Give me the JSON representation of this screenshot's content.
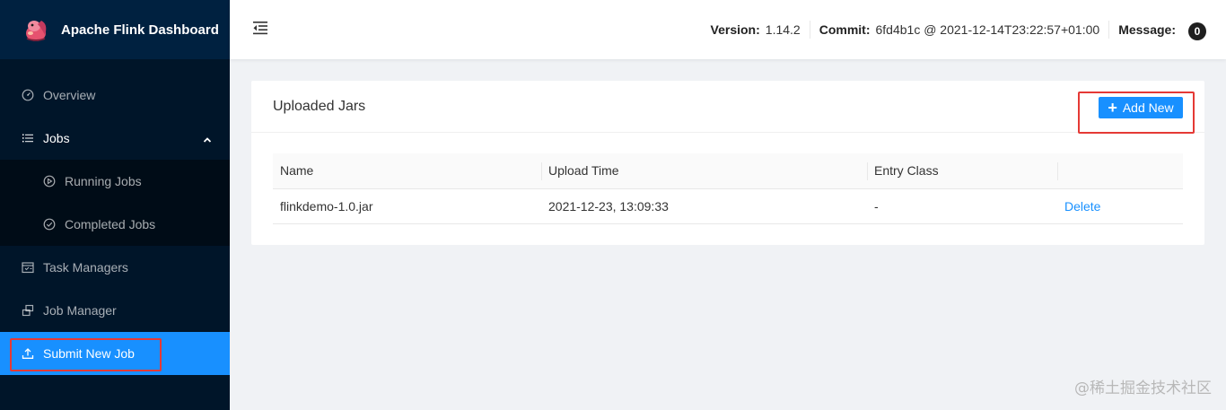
{
  "app": {
    "title": "Apache Flink Dashboard"
  },
  "sidebar": {
    "items": [
      {
        "label": "Overview",
        "icon": "dashboard-icon"
      },
      {
        "label": "Jobs",
        "icon": "list-icon",
        "expanded": true
      },
      {
        "label": "Running Jobs",
        "icon": "play-circle-icon"
      },
      {
        "label": "Completed Jobs",
        "icon": "check-circle-icon"
      },
      {
        "label": "Task Managers",
        "icon": "schedule-icon"
      },
      {
        "label": "Job Manager",
        "icon": "cluster-icon"
      },
      {
        "label": "Submit New Job",
        "icon": "upload-icon",
        "active": true
      }
    ]
  },
  "header": {
    "version_label": "Version:",
    "version_value": "1.14.2",
    "commit_label": "Commit:",
    "commit_value": "6fd4b1c @ 2021-12-14T23:22:57+01:00",
    "message_label": "Message:",
    "message_count": "0"
  },
  "card": {
    "title": "Uploaded Jars",
    "add_label": "Add New",
    "columns": [
      "Name",
      "Upload Time",
      "Entry Class",
      ""
    ],
    "rows": [
      {
        "name": "flinkdemo-1.0.jar",
        "upload_time": "2021-12-23, 13:09:33",
        "entry_class": "-",
        "action": "Delete"
      }
    ]
  },
  "watermark": "@稀土掘金技术社区",
  "colors": {
    "sidebar": "#001529",
    "primary": "#1890ff",
    "highlight": "#e53935"
  }
}
